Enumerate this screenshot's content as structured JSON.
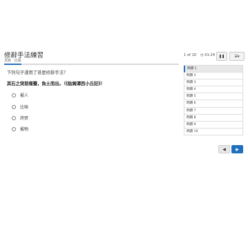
{
  "header": {
    "title": "修辭手法練習",
    "subtitle": "頂真 · 比擬"
  },
  "progress": {
    "fraction": 0.1
  },
  "question": {
    "prompt": "下列句子運用了甚麼修辭手法？",
    "passage": "其石之突怒偃蹇，負土而出。（《鈷鉧潭西小丘記》）",
    "options": [
      "擬人",
      "比喻",
      "誇張",
      "擬物"
    ]
  },
  "toolbar": {
    "counter": "1 of 10",
    "timer": "01:24",
    "timer_icon": "clock-icon",
    "pause_icon": "pause-icon",
    "list_icon": "list-view-icon"
  },
  "question_list": [
    "問題 1",
    "問題 2",
    "問題 3",
    "問題 4",
    "問題 5",
    "問題 6",
    "問題 7",
    "問題 8",
    "問題 9",
    "問題 10"
  ],
  "nav": {
    "prev_icon": "chevron-left-icon",
    "next_icon": "chevron-right-icon"
  },
  "colors": {
    "accent": "#1f6fbf",
    "active_item": "#e8e8e8"
  }
}
